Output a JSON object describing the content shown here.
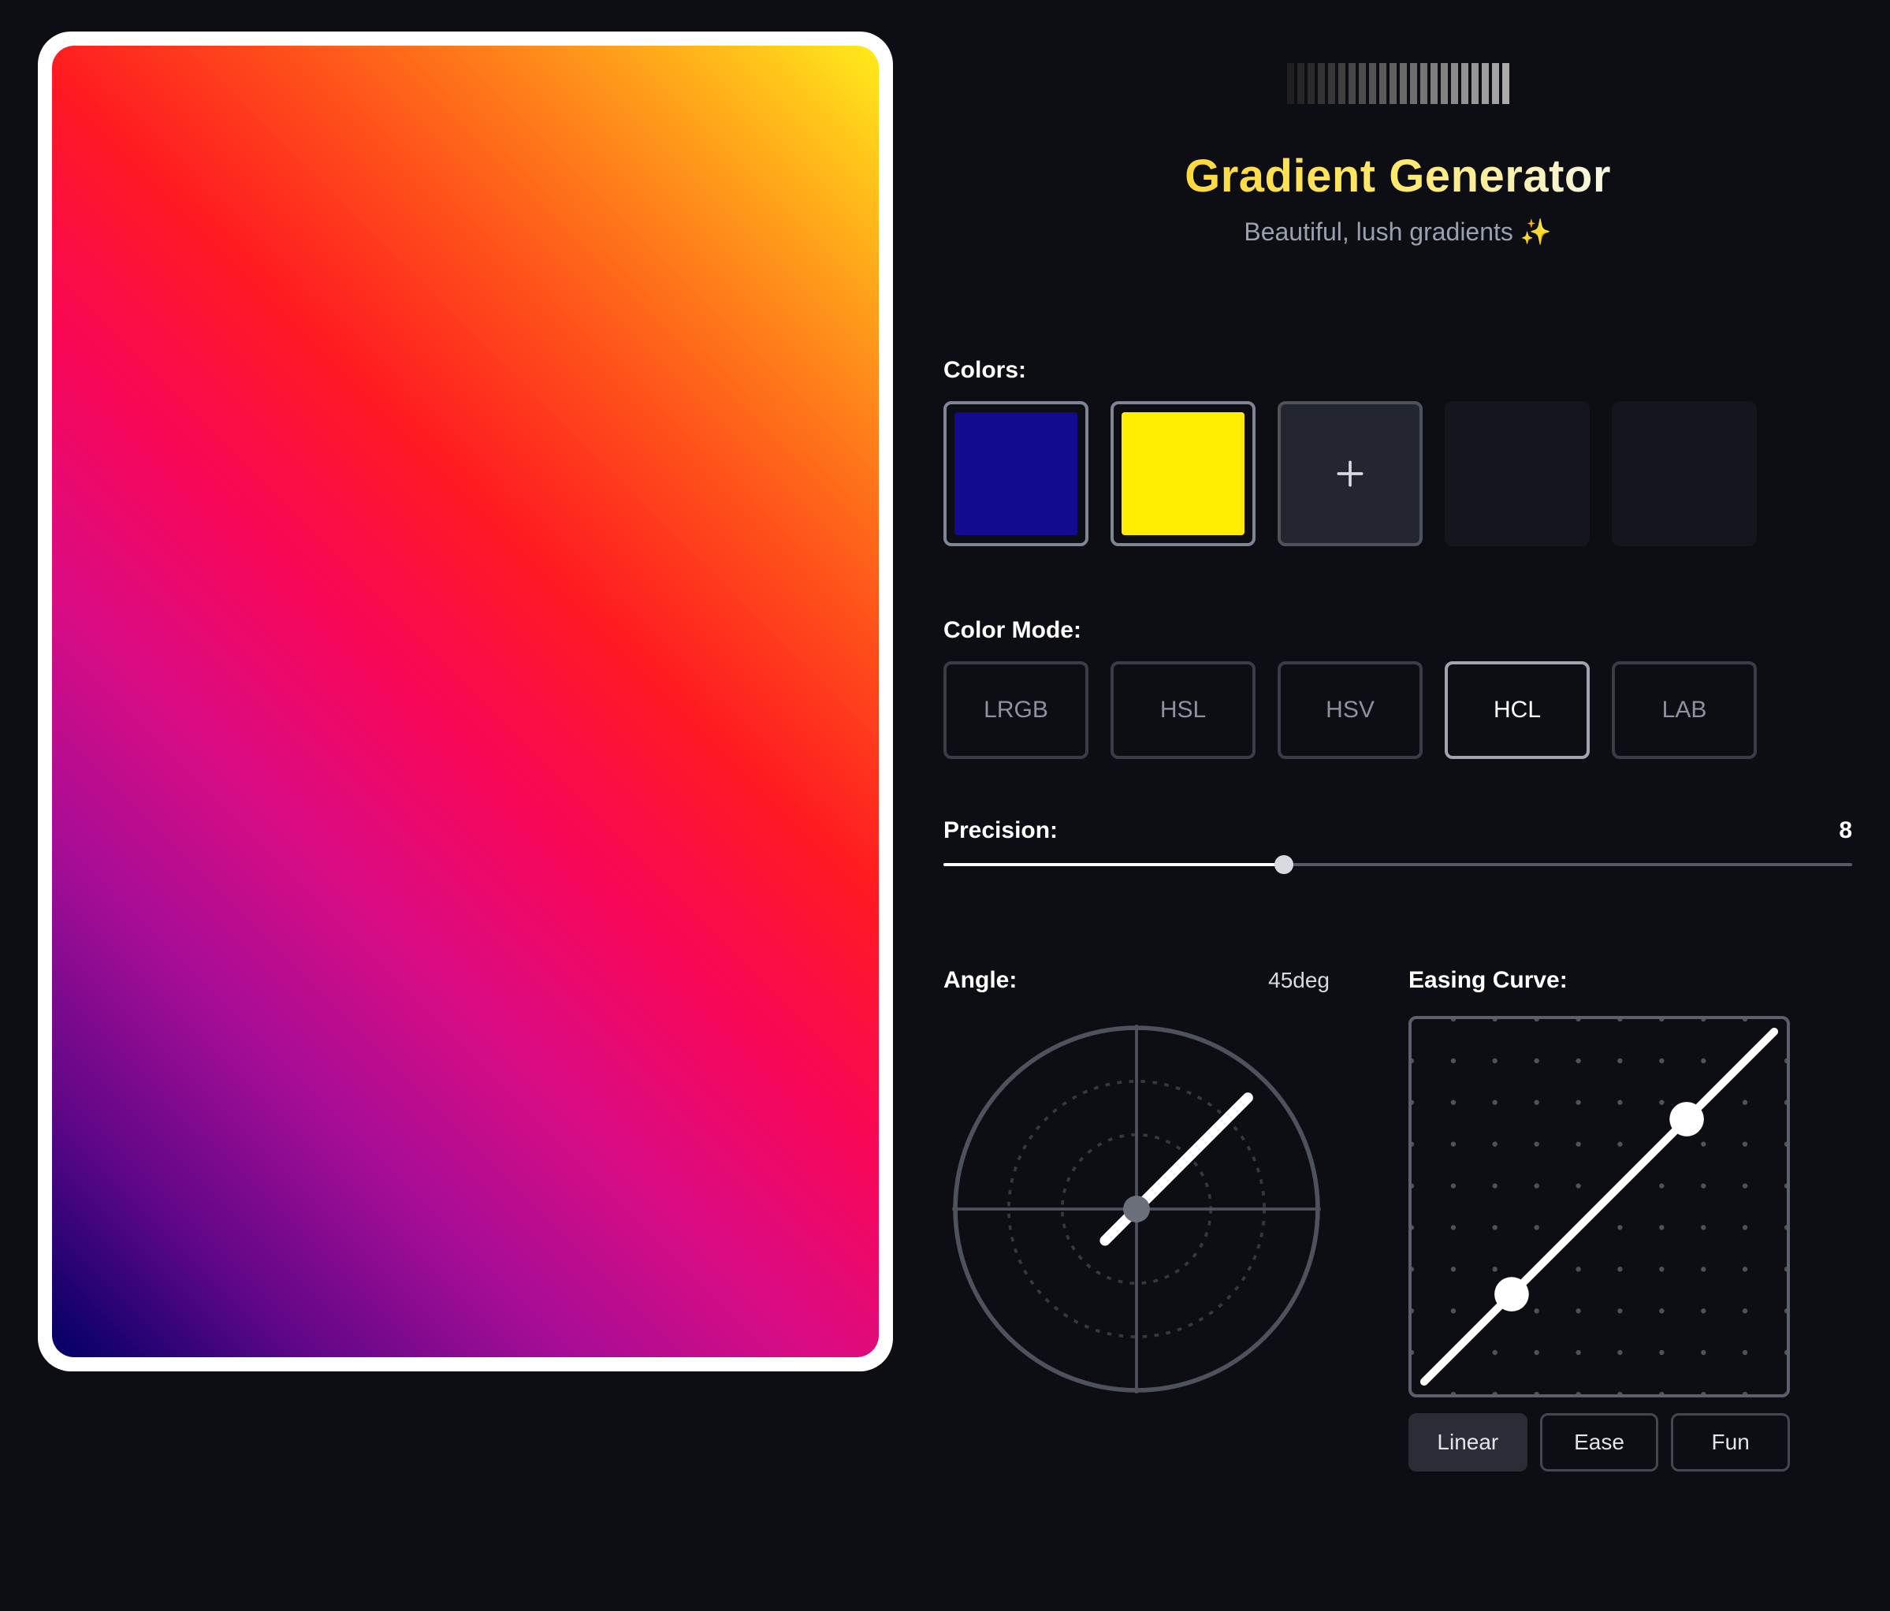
{
  "header": {
    "title": "Gradient Generator",
    "tagline": "Beautiful, lush gradients ✨"
  },
  "colors": {
    "label": "Colors:",
    "swatches": [
      "#120a8f",
      "#ffec00"
    ],
    "max_slots": 5
  },
  "color_mode": {
    "label": "Color Mode:",
    "options": [
      "LRGB",
      "HSL",
      "HSV",
      "HCL",
      "LAB"
    ],
    "selected": "HCL"
  },
  "precision": {
    "label": "Precision:",
    "value": 8,
    "min": 1,
    "max": 20,
    "pct": 37.5
  },
  "angle": {
    "label": "Angle:",
    "value_text": "45deg",
    "degrees": 45
  },
  "easing": {
    "label": "Easing Curve:",
    "presets": [
      "Linear",
      "Ease",
      "Fun"
    ],
    "selected": "Linear",
    "p1": [
      0.25,
      0.25
    ],
    "p2": [
      0.75,
      0.75
    ]
  },
  "preview": {
    "gradient_stops": [
      "hsl(240 100% 20%)",
      "hsl(281 90% 28%)",
      "hsl(306 85% 35%)",
      "hsl(325 90% 45%)",
      "hsl(340 95% 50%)",
      "hsl(358 100% 55%)",
      "hsl(14 100% 55%)",
      "hsl(30 100% 55%)",
      "hsl(45 100% 55%)",
      "hsl(55 100% 55%)"
    ],
    "angle_deg": 45
  }
}
